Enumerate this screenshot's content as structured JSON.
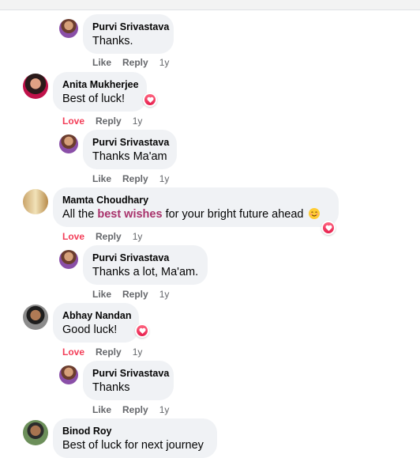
{
  "actions": {
    "like": "Like",
    "love": "Love",
    "reply": "Reply",
    "time": "1y"
  },
  "comments": [
    {
      "author": "Purvi Srivastava",
      "text": "Thanks."
    },
    {
      "author": "Anita Mukherjee",
      "text": "Best of luck!"
    },
    {
      "author": "Purvi Srivastava",
      "text": "Thanks Ma'am"
    },
    {
      "author": "Mamta Choudhary",
      "text_before": "All the ",
      "text_highlight": "best wishes",
      "text_after": " for your bright future ahead"
    },
    {
      "author": "Purvi Srivastava",
      "text": "Thanks a lot, Ma'am."
    },
    {
      "author": "Abhay Nandan",
      "text": "Good luck!"
    },
    {
      "author": "Purvi Srivastava",
      "text": "Thanks"
    },
    {
      "author": "Binod Roy",
      "text": "Best of luck for next journey"
    }
  ],
  "colors": {
    "bubble": "#f0f2f5",
    "love": "#f33e58",
    "highlight": "#a8326b",
    "meta": "#65676b"
  },
  "icons": {
    "reaction": "heart-reaction-icon",
    "emoji": "smiling-face-emoji-icon"
  }
}
